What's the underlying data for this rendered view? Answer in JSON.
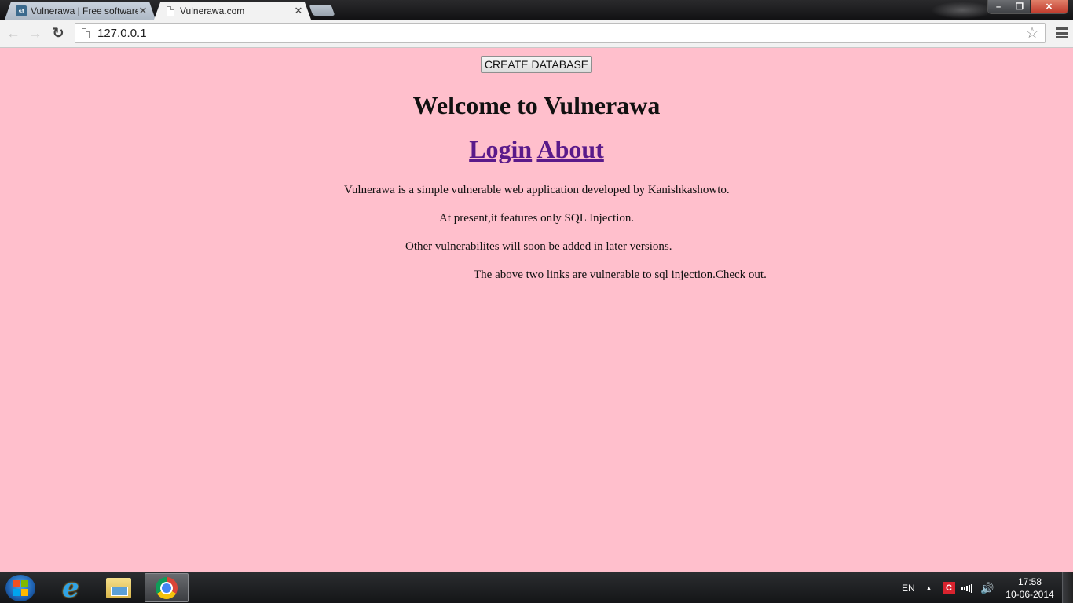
{
  "browser": {
    "tabs": [
      {
        "label": "Vulnerawa | Free software",
        "favicon": "sourceforge-icon",
        "active": false
      },
      {
        "label": "Vulnerawa.com",
        "favicon": "document-icon",
        "active": true
      }
    ],
    "url": "127.0.0.1",
    "window_buttons": {
      "minimize": "–",
      "maximize": "❐",
      "close": "✕"
    },
    "icons": {
      "back": "←",
      "forward": "→",
      "reload": "↻",
      "star": "☆",
      "tab_close": "✕"
    }
  },
  "page": {
    "background": "#ffbfcc",
    "create_button": "CREATE DATABASE",
    "heading": "Welcome to Vulnerawa",
    "links": [
      {
        "label": "Login"
      },
      {
        "label": "About"
      }
    ],
    "link_color": "#5a1a8a",
    "paragraphs": [
      "Vulnerawa is a simple vulnerable web application developed by Kanishkashowto.",
      "At present,it features only SQL Injection.",
      "Other vulnerabilites will soon be added in later versions.",
      "The above two links are vulnerable to sql injection.Check out."
    ]
  },
  "taskbar": {
    "apps": [
      {
        "name": "Internet Explorer",
        "icon": "internet-explorer-icon"
      },
      {
        "name": "Windows Explorer",
        "icon": "folder-icon"
      },
      {
        "name": "Google Chrome",
        "icon": "chrome-icon",
        "active": true
      }
    ],
    "tray": {
      "language": "EN",
      "show_hidden": "▲",
      "antivirus_badge": "C",
      "volume": "🔊"
    },
    "clock": {
      "time": "17:58",
      "date": "10-06-2014"
    }
  }
}
